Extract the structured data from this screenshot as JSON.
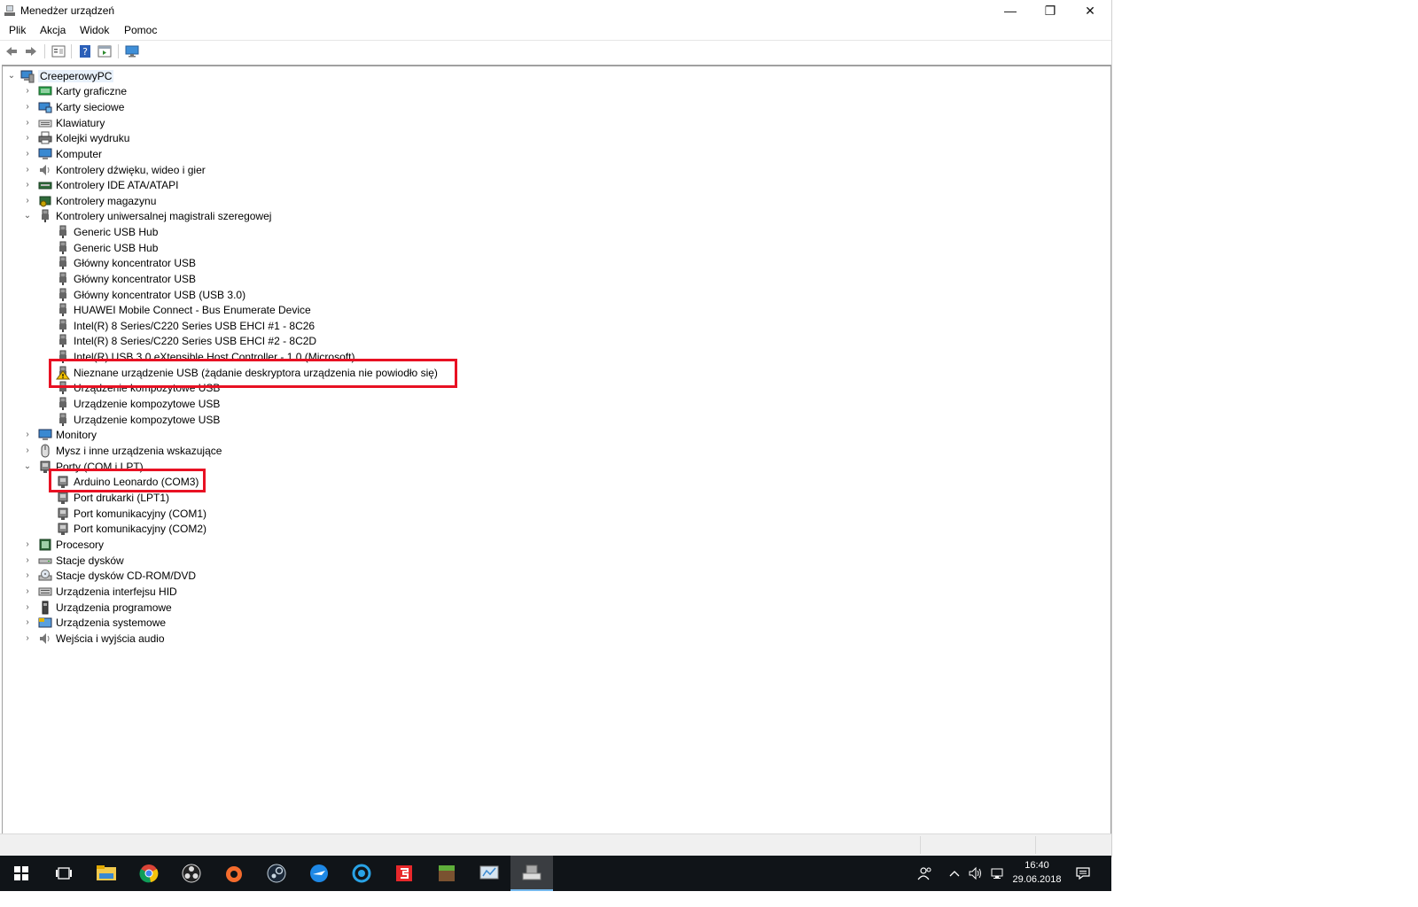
{
  "window": {
    "title": "Menedżer urządzeń",
    "minimize_glyph": "—",
    "restore_glyph": "❐",
    "close_glyph": "✕"
  },
  "menu": {
    "file": "Plik",
    "action": "Akcja",
    "view": "Widok",
    "help": "Pomoc"
  },
  "tree": {
    "root": "CreeperowyPC",
    "categories": {
      "display": "Karty graficzne",
      "network": "Karty sieciowe",
      "keyboards": "Klawiatury",
      "print_queues": "Kolejki wydruku",
      "computer": "Komputer",
      "sound": "Kontrolery dźwięku, wideo i gier",
      "ide": "Kontrolery IDE ATA/ATAPI",
      "storage": "Kontrolery magazynu",
      "usb": "Kontrolery uniwersalnej magistrali szeregowej",
      "monitors": "Monitory",
      "mice": "Mysz i inne urządzenia wskazujące",
      "ports": "Porty (COM i LPT)",
      "processors": "Procesory",
      "disk_drives": "Stacje dysków",
      "cdrom": "Stacje dysków CD-ROM/DVD",
      "hid": "Urządzenia interfejsu HID",
      "software": "Urządzenia programowe",
      "system": "Urządzenia systemowe",
      "audio_io": "Wejścia i wyjścia audio"
    },
    "usb_devices": [
      "Generic USB Hub",
      "Generic USB Hub",
      "Główny koncentrator USB",
      "Główny koncentrator USB",
      "Główny koncentrator USB (USB 3.0)",
      "HUAWEI Mobile Connect - Bus Enumerate Device",
      "Intel(R) 8 Series/C220 Series USB EHCI #1 - 8C26",
      "Intel(R) 8 Series/C220 Series USB EHCI #2 - 8C2D",
      "Intel(R) USB 3.0 eXtensible Host Controller - 1.0 (Microsoft)",
      "Nieznane urządzenie USB (żądanie deskryptora urządzenia nie powiodło się)",
      "Urządzenie kompozytowe USB",
      "Urządzenie kompozytowe USB",
      "Urządzenie kompozytowe USB"
    ],
    "port_devices": [
      "Arduino Leonardo (COM3)",
      "Port drukarki (LPT1)",
      "Port komunikacyjny (COM1)",
      "Port komunikacyjny (COM2)"
    ]
  },
  "taskbar": {
    "time": "16:40",
    "date": "29.06.2018"
  },
  "colors": {
    "highlight_box": "#e81123",
    "taskbar_bg": "#101418",
    "warning": "#f5c400"
  }
}
